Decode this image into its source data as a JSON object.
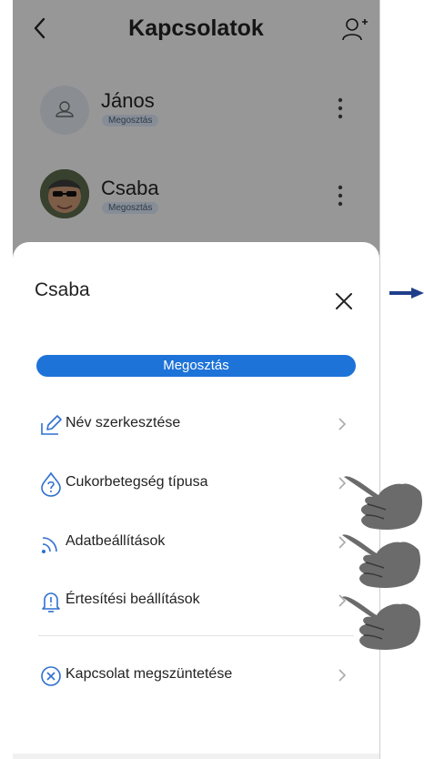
{
  "header": {
    "title": "Kapcsolatok"
  },
  "contacts": [
    {
      "name": "János",
      "badge": "Megosztás",
      "avatar": "placeholder-person-icon"
    },
    {
      "name": "Csaba",
      "badge": "Megosztás",
      "avatar": "photo"
    }
  ],
  "sheet": {
    "contact_name": "Csaba",
    "share_label": "Megosztás",
    "menu": [
      {
        "label": "Név szerkesztése",
        "icon": "edit-icon"
      },
      {
        "label": "Cukorbetegség típusa",
        "icon": "question-drop-icon"
      },
      {
        "label": "Adatbeállítások",
        "icon": "data-signal-icon"
      },
      {
        "label": "Értesítési beállítások",
        "icon": "bell-icon"
      }
    ],
    "remove_label": "Kapcsolat megszüntetése"
  },
  "colors": {
    "accent": "#1e73d8",
    "overlay_arrow": "#1f3e8a",
    "icon_blue": "#2f6fd0"
  }
}
